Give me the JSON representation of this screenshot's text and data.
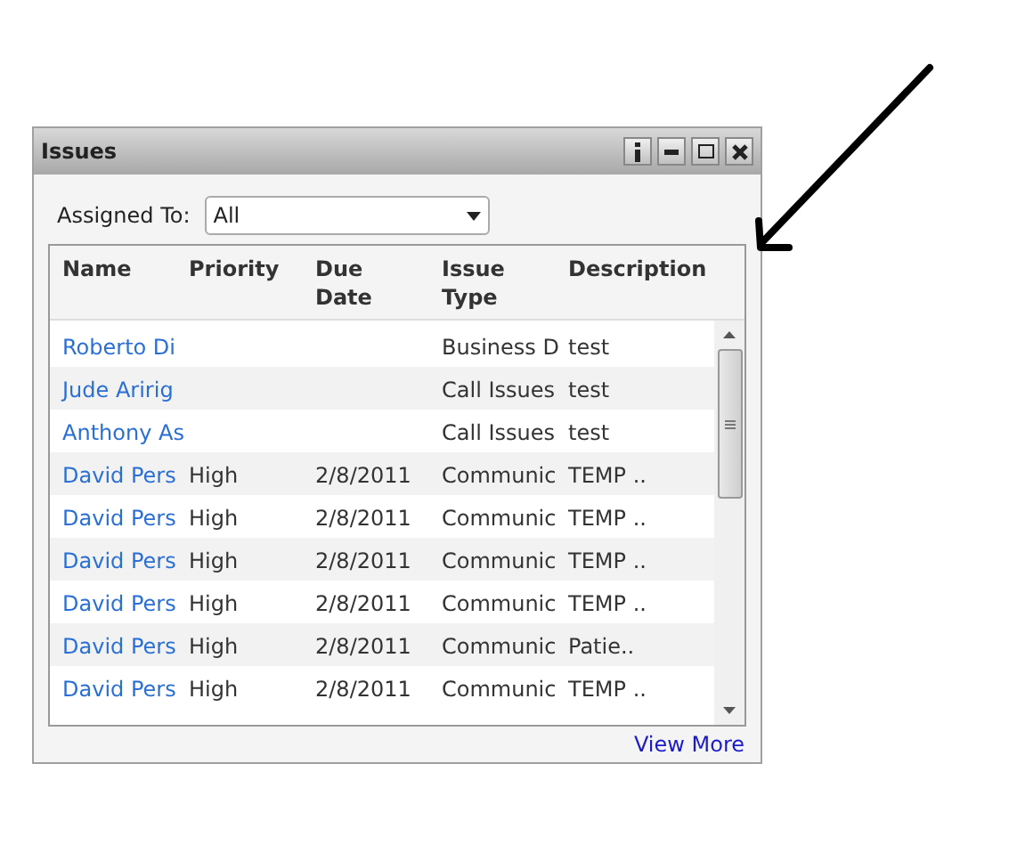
{
  "window": {
    "title": "Issues"
  },
  "filter": {
    "label": "Assigned To:",
    "value": "All"
  },
  "table": {
    "columns": [
      "Name",
      "Priority",
      "Due Date",
      "Issue Type",
      "Description"
    ],
    "rows": [
      {
        "name": "Roberto Di",
        "issue_type": "Business D",
        "description": "test"
      },
      {
        "name": "Jude Aririg",
        "issue_type": "Call Issues",
        "description": "test"
      },
      {
        "name": "Anthony As",
        "issue_type": "Call Issues",
        "description": "test"
      },
      {
        "name": "David Pers",
        "priority": "High",
        "due_date": "2/8/2011",
        "issue_type": "Communic",
        "description": "TEMP .."
      },
      {
        "name": "David Pers",
        "priority": "High",
        "due_date": "2/8/2011",
        "issue_type": "Communic",
        "description": "TEMP .."
      },
      {
        "name": "David Pers",
        "priority": "High",
        "due_date": "2/8/2011",
        "issue_type": "Communic",
        "description": "TEMP .."
      },
      {
        "name": "David Pers",
        "priority": "High",
        "due_date": "2/8/2011",
        "issue_type": "Communic",
        "description": "TEMP .."
      },
      {
        "name": "David Pers",
        "priority": "High",
        "due_date": "2/8/2011",
        "issue_type": "Communic",
        "description": "Patie.."
      },
      {
        "name": "David Pers",
        "priority": "High",
        "due_date": "2/8/2011",
        "issue_type": "Communic",
        "description": "TEMP .."
      }
    ]
  },
  "view_more": "View More"
}
